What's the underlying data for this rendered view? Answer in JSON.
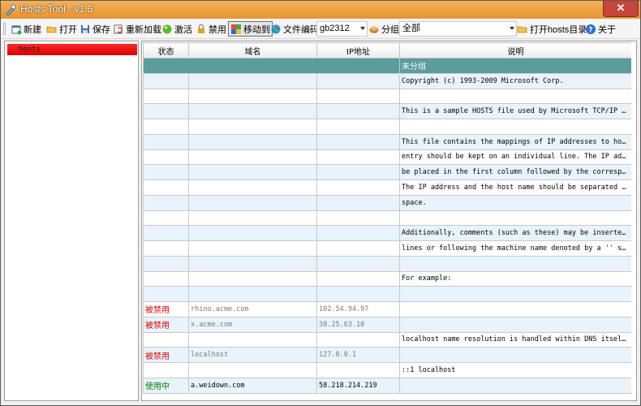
{
  "window": {
    "title": "Hosts Tool - v1.6",
    "close_label": "✕"
  },
  "toolbar": {
    "new": "新建",
    "open": "打开",
    "save": "保存",
    "reload": "重新加载",
    "activate": "激活",
    "disable": "禁用",
    "move_to": "移动到",
    "encoding": "文件编码",
    "encoding_value": "gb2312",
    "group": "分组",
    "group_value": "全部",
    "open_dir": "打开hosts目录",
    "about": "关于"
  },
  "sidebar": {
    "items": [
      {
        "label": "hosts"
      }
    ]
  },
  "grid": {
    "columns": [
      "状态",
      "域名",
      "IP地址",
      "说明"
    ],
    "group_label": "未分组",
    "rows": [
      {
        "status": "",
        "domain": "",
        "ip": "",
        "note": "Copyright (c) 1993-2009 Microsoft Corp."
      },
      {
        "status": "",
        "domain": "",
        "ip": "",
        "note": ""
      },
      {
        "status": "",
        "domain": "",
        "ip": "",
        "note": "This is a sample HOSTS file used by Microsoft TCP/IP for..."
      },
      {
        "status": "",
        "domain": "",
        "ip": "",
        "note": ""
      },
      {
        "status": "",
        "domain": "",
        "ip": "",
        "note": "This file contains the mappings of IP addresses to host ..."
      },
      {
        "status": "",
        "domain": "",
        "ip": "",
        "note": "entry should be kept on an individual line. The IP addre..."
      },
      {
        "status": "",
        "domain": "",
        "ip": "",
        "note": "be placed in the first column followed by the correspond..."
      },
      {
        "status": "",
        "domain": "",
        "ip": "",
        "note": "The IP address and the host name should be separated by ..."
      },
      {
        "status": "",
        "domain": "",
        "ip": "",
        "note": "space."
      },
      {
        "status": "",
        "domain": "",
        "ip": "",
        "note": ""
      },
      {
        "status": "",
        "domain": "",
        "ip": "",
        "note": "Additionally, comments (such as these) may be inserted o..."
      },
      {
        "status": "",
        "domain": "",
        "ip": "",
        "note": "lines or following the machine name denoted by a '' symbol."
      },
      {
        "status": "",
        "domain": "",
        "ip": "",
        "note": ""
      },
      {
        "status": "",
        "domain": "",
        "ip": "",
        "note": "For example:"
      },
      {
        "status": "",
        "domain": "",
        "ip": "",
        "note": ""
      },
      {
        "status": "被禁用",
        "domain": "rhino.acme.com",
        "ip": "102.54.94.97",
        "note": ""
      },
      {
        "status": "被禁用",
        "domain": "x.acme.com",
        "ip": "38.25.63.10",
        "note": ""
      },
      {
        "status": "",
        "domain": "",
        "ip": "",
        "note": "localhost name resolution is handled within DNS itself."
      },
      {
        "status": "被禁用",
        "domain": "localhost",
        "ip": "127.0.0.1",
        "note": ""
      },
      {
        "status": "",
        "domain": "",
        "ip": "",
        "note": "::1 localhost"
      },
      {
        "status": "使用中",
        "domain": "a.weidown.com",
        "ip": "58.218.214.219",
        "note": ""
      }
    ]
  },
  "colors": {
    "titlebar": "#e8922e",
    "group_row": "#5b9c9c",
    "alt_row": "#e8f3fb",
    "disabled_text": "#e00000",
    "active_text": "#008000",
    "sidebar_selected": "#e00000"
  }
}
